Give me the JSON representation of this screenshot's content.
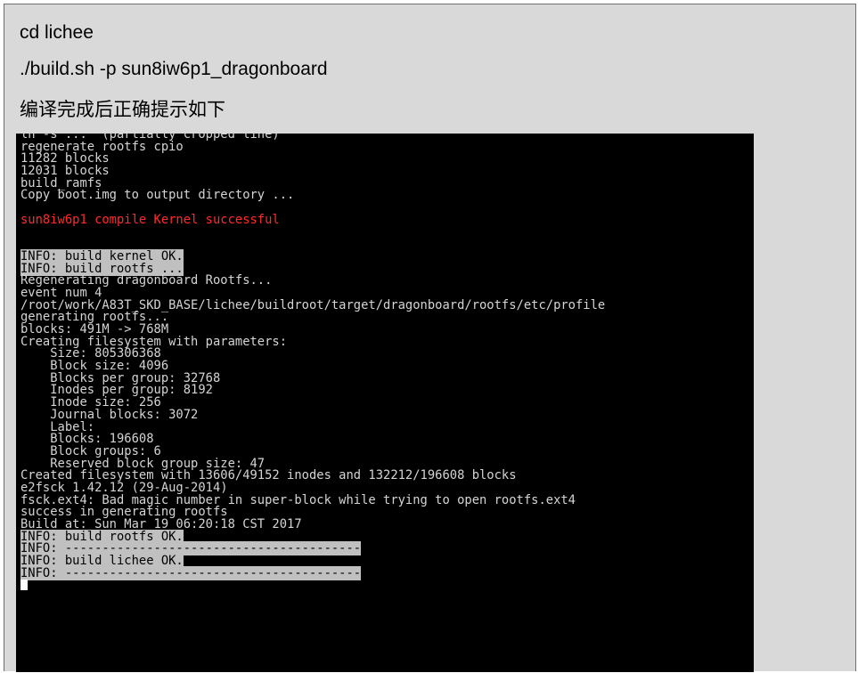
{
  "document": {
    "lines": [
      "cd lichee",
      "./build.sh -p sun8iw6p1_dragonboard",
      "编译完成后正确提示如下"
    ]
  },
  "terminal": {
    "lines": [
      {
        "text": "ln -s ...  (partially cropped line)",
        "style": "normal"
      },
      {
        "text": "regenerate rootfs cpio",
        "style": "normal"
      },
      {
        "text": "11282 blocks",
        "style": "normal"
      },
      {
        "text": "12031 blocks",
        "style": "normal"
      },
      {
        "text": "build_ramfs",
        "style": "normal"
      },
      {
        "text": "Copy boot.img to output directory ...",
        "style": "normal"
      },
      {
        "text": "",
        "style": "normal"
      },
      {
        "text": "sun8iw6p1 compile Kernel successful",
        "style": "red"
      },
      {
        "text": "",
        "style": "normal"
      },
      {
        "text": "",
        "style": "normal"
      },
      {
        "text": "INFO: build kernel OK.",
        "style": "highlight"
      },
      {
        "text": "INFO: build rootfs ...",
        "style": "highlight"
      },
      {
        "text": "Regenerating dragonboard Rootfs...",
        "style": "normal"
      },
      {
        "text": "event num 4",
        "style": "normal"
      },
      {
        "text": "/root/work/A83T_SKD_BASE/lichee/buildroot/target/dragonboard/rootfs/etc/profile",
        "style": "normal"
      },
      {
        "text": "generating rootfs...",
        "style": "normal"
      },
      {
        "text": "blocks: 491M -> 768M",
        "style": "normal"
      },
      {
        "text": "Creating filesystem with parameters:",
        "style": "normal"
      },
      {
        "text": "    Size: 805306368",
        "style": "normal"
      },
      {
        "text": "    Block size: 4096",
        "style": "normal"
      },
      {
        "text": "    Blocks per group: 32768",
        "style": "normal"
      },
      {
        "text": "    Inodes per group: 8192",
        "style": "normal"
      },
      {
        "text": "    Inode size: 256",
        "style": "normal"
      },
      {
        "text": "    Journal blocks: 3072",
        "style": "normal"
      },
      {
        "text": "    Label:",
        "style": "normal"
      },
      {
        "text": "    Blocks: 196608",
        "style": "normal"
      },
      {
        "text": "    Block groups: 6",
        "style": "normal"
      },
      {
        "text": "    Reserved block group size: 47",
        "style": "normal"
      },
      {
        "text": "Created filesystem with 13606/49152 inodes and 132212/196608 blocks",
        "style": "normal"
      },
      {
        "text": "e2fsck 1.42.12 (29-Aug-2014)",
        "style": "normal"
      },
      {
        "text": "fsck.ext4: Bad magic number in super-block while trying to open rootfs.ext4",
        "style": "normal"
      },
      {
        "text": "success in generating rootfs",
        "style": "normal"
      },
      {
        "text": "Build at: Sun Mar 19 06:20:18 CST 2017",
        "style": "normal"
      },
      {
        "text": "INFO: build rootfs OK.",
        "style": "highlight"
      },
      {
        "text": "INFO: ----------------------------------------",
        "style": "highlight"
      },
      {
        "text": "INFO: build lichee OK.",
        "style": "highlight"
      },
      {
        "text": "INFO: ----------------------------------------",
        "style": "highlight"
      },
      {
        "text": "",
        "style": "cursor"
      }
    ]
  },
  "colors": {
    "page_background": "#d9d9d9",
    "terminal_background": "#000000",
    "terminal_text": "#d4d4d4",
    "success_text": "#ff2b2b",
    "highlight_background": "#c0c0c0"
  }
}
